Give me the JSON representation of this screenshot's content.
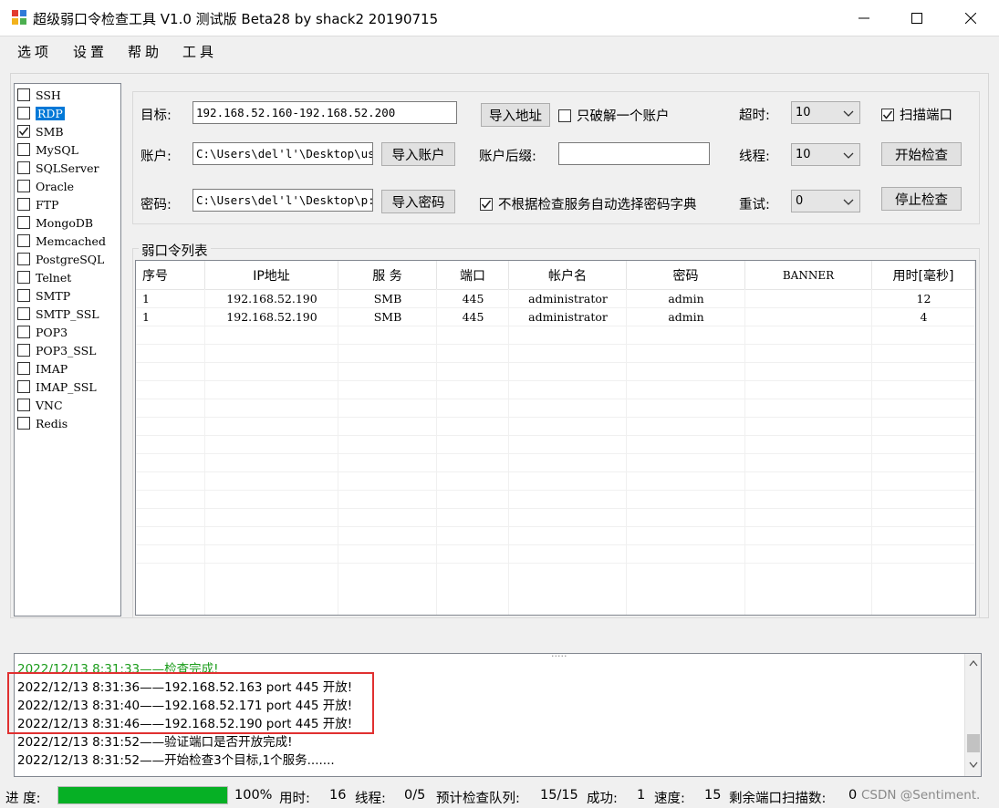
{
  "window": {
    "title": "超级弱口令检查工具 V1.0 测试版 Beta28 by shack2 20190715",
    "controls": [
      "—",
      "□",
      "✕"
    ]
  },
  "menu": [
    "选项",
    "设置",
    "帮助",
    "工具"
  ],
  "services": [
    {
      "label": "SSH",
      "checked": false,
      "selected": false
    },
    {
      "label": "RDP",
      "checked": false,
      "selected": true
    },
    {
      "label": "SMB",
      "checked": true,
      "selected": false
    },
    {
      "label": "MySQL",
      "checked": false,
      "selected": false
    },
    {
      "label": "SQLServer",
      "checked": false,
      "selected": false
    },
    {
      "label": "Oracle",
      "checked": false,
      "selected": false
    },
    {
      "label": "FTP",
      "checked": false,
      "selected": false
    },
    {
      "label": "MongoDB",
      "checked": false,
      "selected": false
    },
    {
      "label": "Memcached",
      "checked": false,
      "selected": false
    },
    {
      "label": "PostgreSQL",
      "checked": false,
      "selected": false
    },
    {
      "label": "Telnet",
      "checked": false,
      "selected": false
    },
    {
      "label": "SMTP",
      "checked": false,
      "selected": false
    },
    {
      "label": "SMTP_SSL",
      "checked": false,
      "selected": false
    },
    {
      "label": "POP3",
      "checked": false,
      "selected": false
    },
    {
      "label": "POP3_SSL",
      "checked": false,
      "selected": false
    },
    {
      "label": "IMAP",
      "checked": false,
      "selected": false
    },
    {
      "label": "IMAP_SSL",
      "checked": false,
      "selected": false
    },
    {
      "label": "VNC",
      "checked": false,
      "selected": false
    },
    {
      "label": "Redis",
      "checked": false,
      "selected": false
    }
  ],
  "form": {
    "target_label": "目标:",
    "target_value": "192.168.52.160-192.168.52.200",
    "import_address_btn": "导入地址",
    "only_one_account_label": "只破解一个账户",
    "only_one_account_checked": false,
    "timeout_label": "超时:",
    "timeout_value": "10",
    "scan_port_label": "扫描端口",
    "scan_port_checked": true,
    "account_label": "账户:",
    "account_value": "C:\\Users\\del'l'\\Desktop\\us",
    "import_account_btn": "导入账户",
    "account_suffix_label": "账户后缀:",
    "account_suffix_value": "",
    "threads_label": "线程:",
    "threads_value": "10",
    "start_btn": "开始检查",
    "password_label": "密码:",
    "password_value": "C:\\Users\\del'l'\\Desktop\\p:",
    "import_password_btn": "导入密码",
    "no_auto_dict_label": "不根据检查服务自动选择密码字典",
    "no_auto_dict_checked": true,
    "retry_label": "重试:",
    "retry_value": "0",
    "stop_btn": "停止检查"
  },
  "results": {
    "group_title": "弱口令列表",
    "columns": [
      "序号",
      "IP地址",
      "服 务",
      "端口",
      "帐户名",
      "密码",
      "BANNER",
      "用时[毫秒]"
    ],
    "rows": [
      [
        "1",
        "192.168.52.190",
        "SMB",
        "445",
        "administrator",
        "admin",
        "",
        "12"
      ],
      [
        "1",
        "192.168.52.190",
        "SMB",
        "445",
        "administrator",
        "admin",
        "",
        "4"
      ]
    ]
  },
  "log": {
    "top_cut": ".....",
    "lines": [
      {
        "text": "2022/12/13 8:31:33——检查完成!",
        "green": true
      },
      {
        "text": "2022/12/13 8:31:36——192.168.52.163 port 445 开放!",
        "green": false
      },
      {
        "text": "2022/12/13 8:31:40——192.168.52.171 port 445 开放!",
        "green": false
      },
      {
        "text": "2022/12/13 8:31:46——192.168.52.190 port 445 开放!",
        "green": false
      },
      {
        "text": "2022/12/13 8:31:52——验证端口是否开放完成!",
        "green": false
      },
      {
        "text": "2022/12/13 8:31:52——开始检查3个目标,1个服务.......",
        "green": false
      }
    ]
  },
  "status": {
    "progress_label": "进 度:",
    "progress_percent": 100,
    "progress_text": "100%",
    "time_label": "用时:",
    "time_value": "16",
    "thread_label": "线程:",
    "thread_value": "0/5",
    "queue_label": "预计检查队列:",
    "queue_value": "15/15",
    "success_label": "成功:",
    "success_value": "1",
    "speed_label": "速度:",
    "speed_value": "15",
    "remain_label": "剩余端口扫描数:",
    "remain_value": "0",
    "watermark": "CSDN @Sentiment."
  },
  "colors": {
    "selection": "#0078d7",
    "progress": "#06b025",
    "log_green": "#1a9c1a",
    "highlight_box": "#e03030"
  }
}
